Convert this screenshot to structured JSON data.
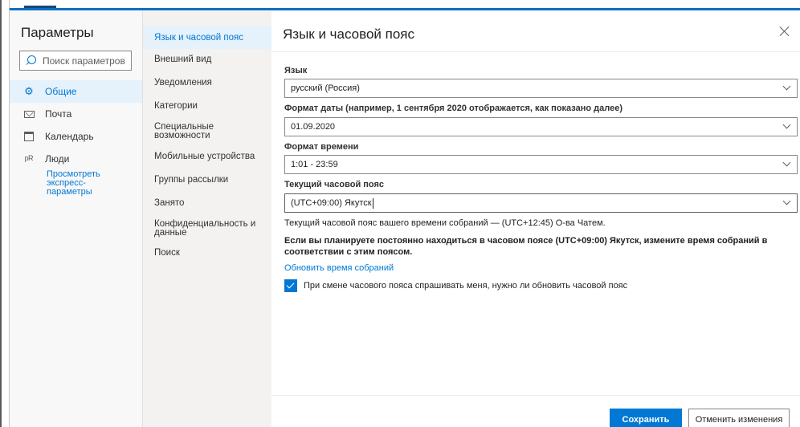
{
  "sidebar": {
    "title": "Параметры",
    "search_placeholder": "Поиск параметров",
    "items": [
      {
        "label": "Общие",
        "icon": "gear-icon"
      },
      {
        "label": "Почта",
        "icon": "mail-icon"
      },
      {
        "label": "Календарь",
        "icon": "calendar-icon"
      },
      {
        "label": "Люди",
        "icon": "people-icon"
      }
    ],
    "quick_settings_link": [
      "Просмотреть",
      "экспресс-",
      "параметры"
    ]
  },
  "subnav": {
    "items": [
      {
        "label": "Язык и часовой пояс"
      },
      {
        "label": "Внешний вид"
      },
      {
        "label": "Уведомления"
      },
      {
        "label": "Категории"
      },
      {
        "label_lines": [
          "Специальные",
          "возможности"
        ]
      },
      {
        "label": "Мобильные устройства"
      },
      {
        "label": "Группы рассылки"
      },
      {
        "label": "Занято"
      },
      {
        "label_lines": [
          "Конфиденциальность и",
          "данные"
        ]
      },
      {
        "label": "Поиск"
      }
    ]
  },
  "pane": {
    "title": "Язык и часовой пояс",
    "language": {
      "label": "Язык",
      "value": "русский (Россия)"
    },
    "date_format": {
      "label": "Формат даты (например, 1 сентября 2020 отображается, как показано далее)",
      "value": "01.09.2020"
    },
    "time_format": {
      "label": "Формат времени",
      "value": "1:01 - 23:59"
    },
    "timezone": {
      "label": "Текущий часовой пояс",
      "value": "(UTC+09:00) Якутск"
    },
    "meeting_tz_info": "Текущий часовой пояс вашего времени собраний — (UTC+12:45) О-ва Чатем.",
    "plan_notice": "Если вы планируете постоянно находиться в часовом поясе (UTC+09:00) Якутск, измените время собраний в соответствии с этим поясом.",
    "update_link": "Обновить время собраний",
    "ask_checkbox": {
      "label": "При смене часового пояса спрашивать меня, нужно ли обновить часовой пояс",
      "checked": true
    },
    "save_label": "Сохранить",
    "cancel_label": "Отменить изменения"
  },
  "colors": {
    "accent": "#0078d4",
    "active_bg": "#e5f1fb"
  }
}
